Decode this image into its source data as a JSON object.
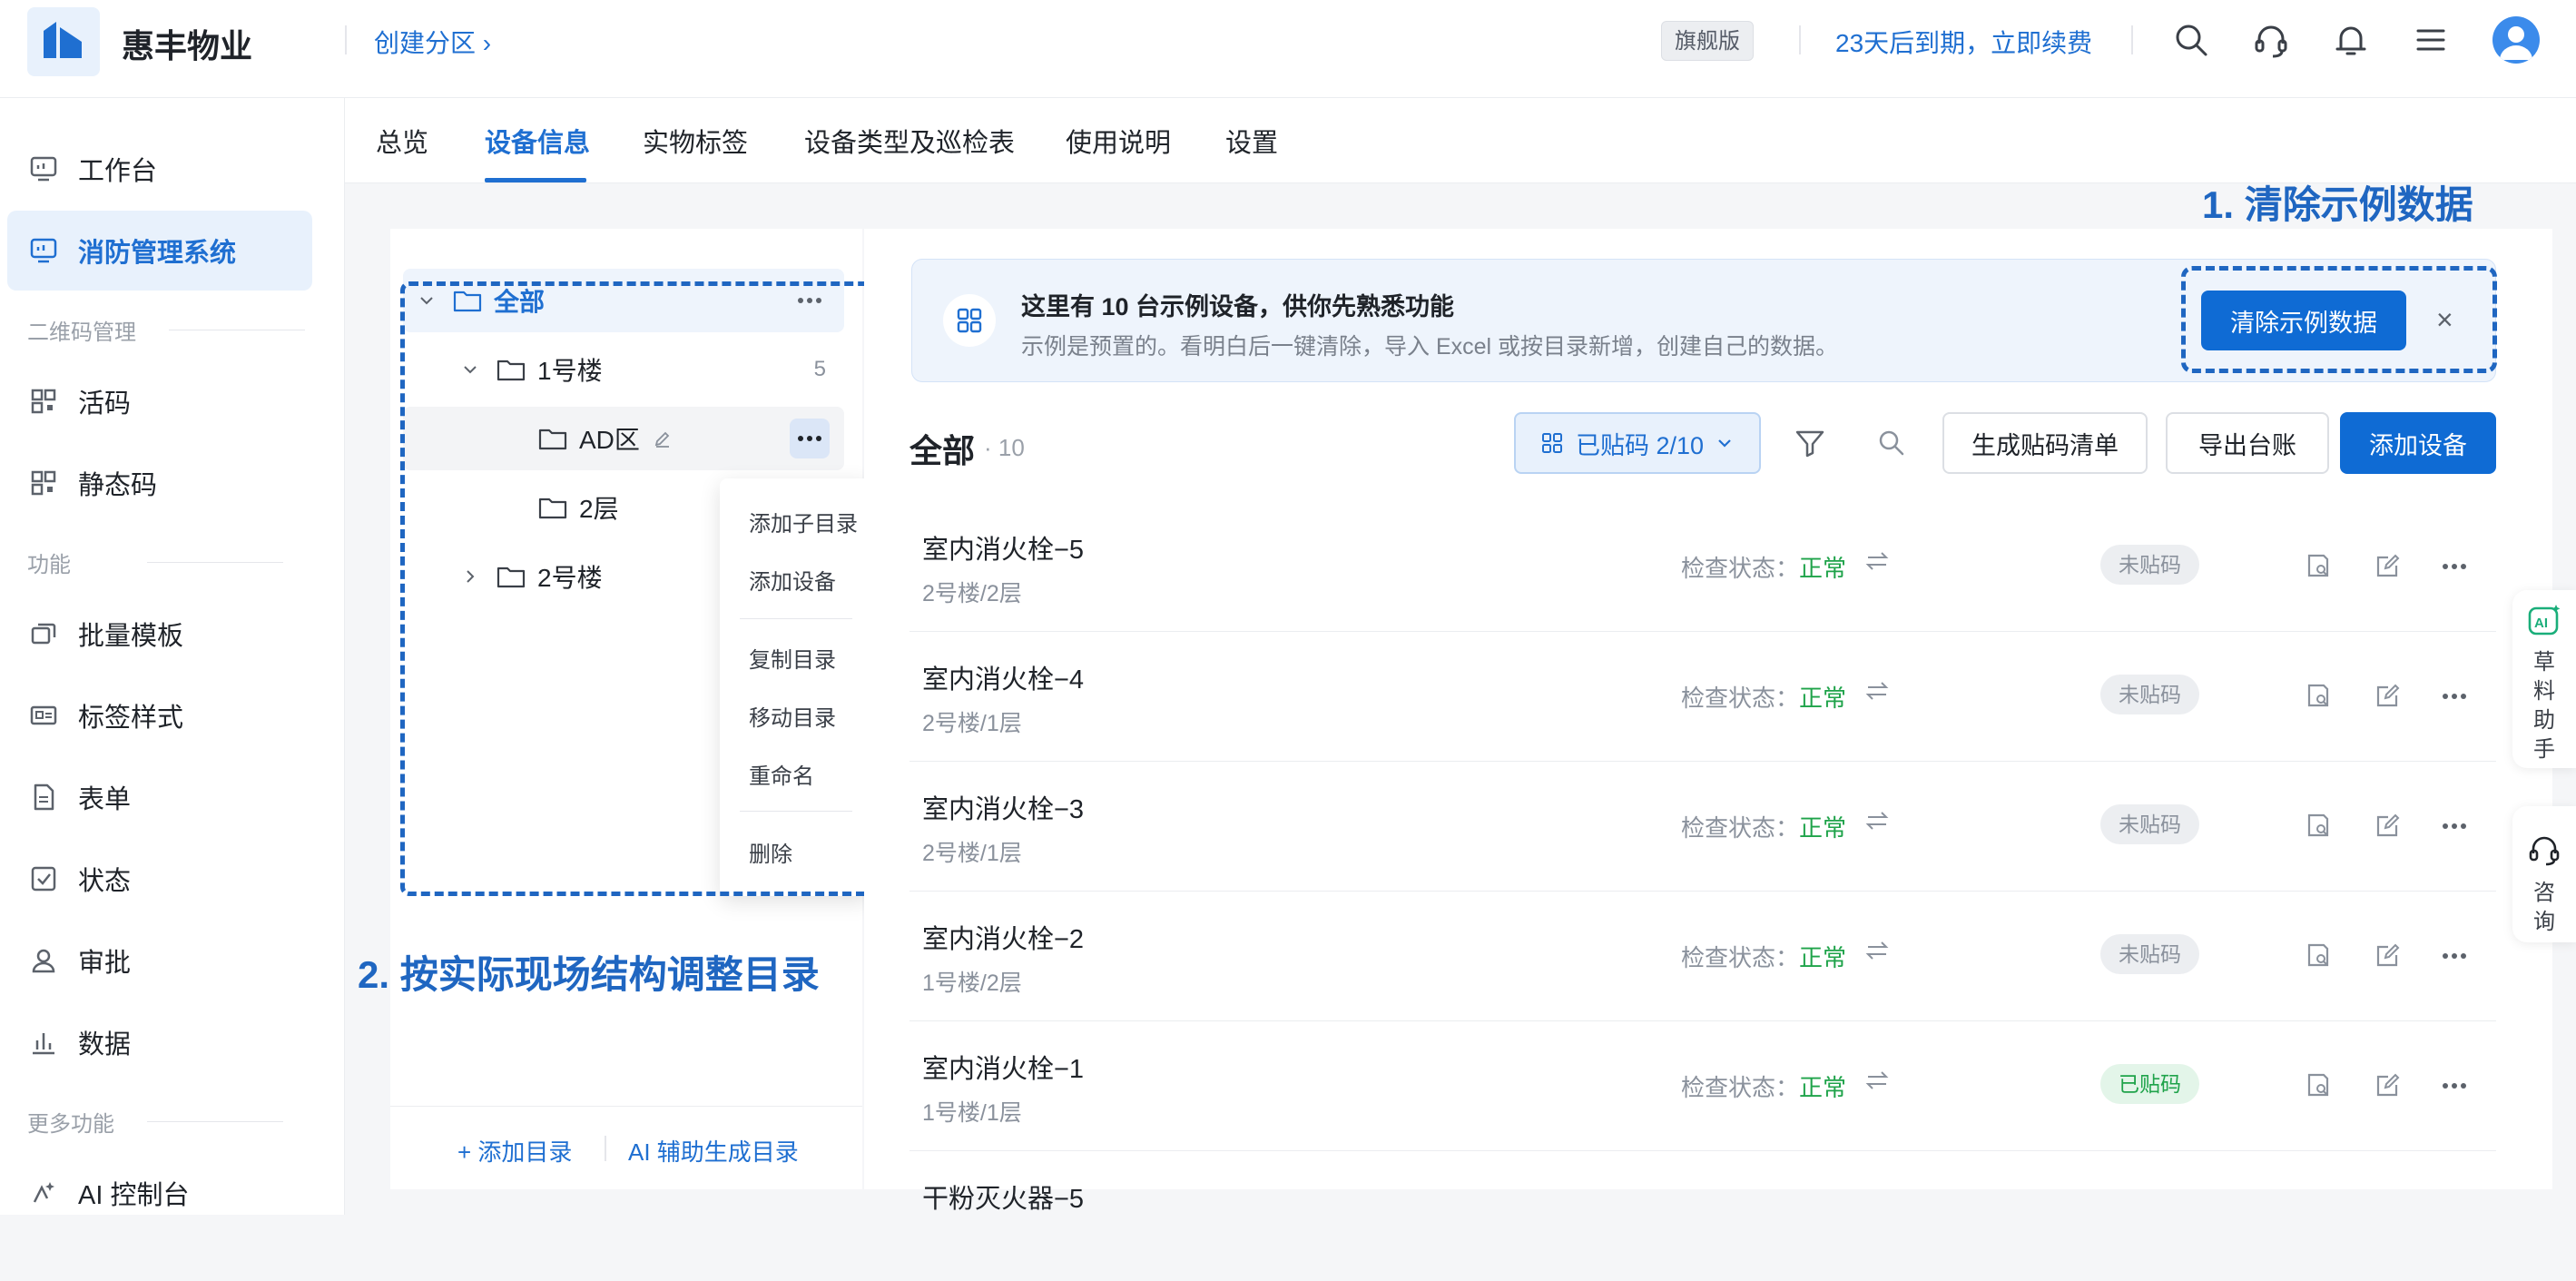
{
  "app": {
    "brand": "惠丰物业",
    "create_zone": "创建分区 ›",
    "edition": "旗舰版",
    "expire_notice": "23天后到期，立即续费"
  },
  "top_icons": [
    "search-icon",
    "headset-icon",
    "bell-icon",
    "menu-icon"
  ],
  "sidebar": {
    "items": [
      {
        "label": "工作台",
        "icon": "dashboard-icon"
      },
      {
        "label": "消防管理系统",
        "icon": "monitor-icon",
        "active": true
      }
    ],
    "group_qr": "二维码管理",
    "qr_items": [
      {
        "label": "活码",
        "icon": "qrcode-icon"
      },
      {
        "label": "静态码",
        "icon": "qrcode-icon"
      }
    ],
    "group_func": "功能",
    "func_items": [
      {
        "label": "批量模板",
        "icon": "copy-icon"
      },
      {
        "label": "标签样式",
        "icon": "tag-icon"
      },
      {
        "label": "表单",
        "icon": "form-icon"
      },
      {
        "label": "状态",
        "icon": "check-icon"
      },
      {
        "label": "审批",
        "icon": "user-icon"
      },
      {
        "label": "数据",
        "icon": "chart-icon"
      }
    ],
    "group_more": "更多功能",
    "more_items": [
      {
        "label": "AI 控制台",
        "icon": "ai-icon"
      }
    ]
  },
  "tabs": [
    "总览",
    "设备信息",
    "实物标签",
    "设备类型及巡检表",
    "使用说明",
    "设置"
  ],
  "active_tab": "设备信息",
  "tree": {
    "root": "全部",
    "nodes": [
      {
        "label": "1号楼",
        "count": "5"
      },
      {
        "label": "AD区"
      },
      {
        "label": "2层"
      },
      {
        "label": "2号楼"
      }
    ],
    "add_dir": "+ 添加目录",
    "ai_dir": "AI 辅助生成目录"
  },
  "context_menu": [
    "添加子目录",
    "添加设备",
    "复制目录",
    "移动目录",
    "重命名",
    "删除"
  ],
  "annotations": {
    "step1": "1. 清除示例数据",
    "step2": "2. 按实际现场结构调整目录"
  },
  "banner": {
    "title": "这里有 10 台示例设备，供你先熟悉功能",
    "subtitle": "示例是预置的。看明白后一键清除，导入 Excel 或按目录新增，创建自己的数据。",
    "clear_button": "清除示例数据",
    "close": "×"
  },
  "list": {
    "title": "全部",
    "count": "· 10",
    "filter_label": "已贴码 2/10",
    "btn_generate": "生成贴码清单",
    "btn_export": "导出台账",
    "btn_add": "添加设备",
    "status_label": "检查状态：",
    "rows": [
      {
        "name": "室内消火栓−5",
        "location": "2号楼/2层",
        "status": "正常",
        "tag": "未贴码",
        "tagged": false
      },
      {
        "name": "室内消火栓−4",
        "location": "2号楼/1层",
        "status": "正常",
        "tag": "未贴码",
        "tagged": false
      },
      {
        "name": "室内消火栓−3",
        "location": "2号楼/1层",
        "status": "正常",
        "tag": "未贴码",
        "tagged": false
      },
      {
        "name": "室内消火栓−2",
        "location": "1号楼/2层",
        "status": "正常",
        "tag": "未贴码",
        "tagged": false
      },
      {
        "name": "室内消火栓−1",
        "location": "1号楼/1层",
        "status": "正常",
        "tag": "已贴码",
        "tagged": true
      },
      {
        "name": "干粉灭火器−5",
        "location": "",
        "status": "",
        "tag": "",
        "tagged": false
      }
    ]
  },
  "floating": {
    "ai_label": "草料助手",
    "consult_label": "咨询"
  },
  "colors": {
    "primary": "#0f6bd4",
    "annotation": "#1f66c1",
    "ok": "#1fa34a"
  }
}
